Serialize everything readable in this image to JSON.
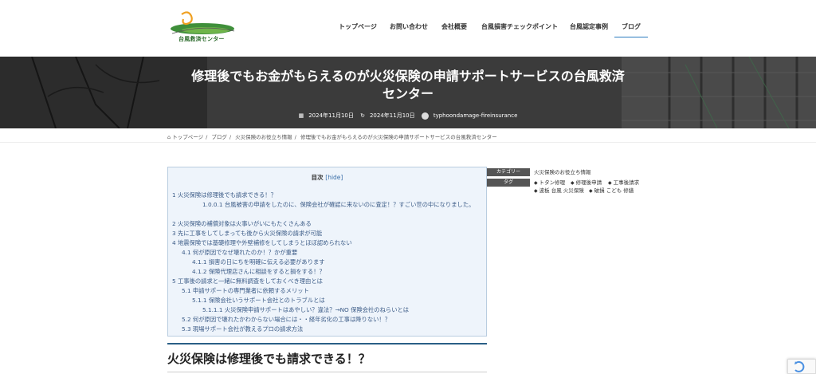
{
  "header": {
    "logo_text": "台風救済センター",
    "nav": [
      {
        "label": "トップページ"
      },
      {
        "label": "お問い合わせ"
      },
      {
        "label": "会社概要"
      },
      {
        "label": "台風損害チェックポイント"
      },
      {
        "label": "台風認定事例"
      },
      {
        "label": "ブログ"
      }
    ],
    "active_index": 5
  },
  "hero": {
    "title_line1": "修理後でもお金がもらえるのが火災保険の申請サポートサービスの台風救済",
    "title_line2": "センター",
    "published": "2024年11月10日",
    "updated": "2024年11月10日",
    "author": "typhoondamage-fireinsurance"
  },
  "breadcrumb": [
    "トップページ",
    "ブログ",
    "火災保険のお役立ち情報",
    "修理後でもお金がもらえるのが火災保険の申請サポートサービスの台風救済センター"
  ],
  "toc": {
    "title": "目次",
    "hide_label": "[hide]",
    "items": [
      "1 火災保険は修理後でも請求できる！？",
      "1.0.0.1 台風被害の申請をしたのに、保険会社が確認に来ないのに査定！？すごい世の中になりました。",
      "2 火災保険の補償対象は火事いがいにもたくさんある",
      "3 先に工事をしてしまっても後から火災保険の請求が可能",
      "4 地震保険では基礎修理や外壁補修をしてしまうとほぼ認められない",
      "4.1 何が原因でなぜ壊れたのか！？かが重要",
      "4.1.1 損害の日にちを明確に伝える必要があります",
      "4.1.2 保険代理店さんに相談をすると損をする！？",
      "5 工事後の請求と一緒に無料調査をしておくべき理由とは",
      "5.1 申請サポートの専門業者に依頼するメリット",
      "5.1.1 保険会社いうサポート会社とのトラブルとは",
      "5.1.1.1 火災保険申請サポートはあやしい？違法？→NO 保険会社のねらいとは",
      "5.2 何が原因で壊れたかわからない場合には・・経年劣化の工事は降りない！？",
      "5.3 現場サポート会社が教えるプロの請求方法"
    ]
  },
  "article": {
    "h2": "火災保険は修理後でも請求できる！？"
  },
  "post_meta": {
    "category_label": "カテゴリー",
    "category_value": "火災保険のお役立ち情報",
    "tag_label": "タグ",
    "tags": [
      "トタン修理",
      "修理後申請",
      "工事後請求",
      "波板 台風 火災保険",
      "破損 こども 修繕"
    ]
  },
  "icons": {
    "calendar": "calendar-icon",
    "updated": "history-icon",
    "home": "home-icon",
    "tag": "tag-icon"
  },
  "colors": {
    "accent": "#2a7bbf",
    "toc_bg": "#eef4fb",
    "toc_link": "#3a5a86",
    "meta_label_bg": "#555555"
  }
}
